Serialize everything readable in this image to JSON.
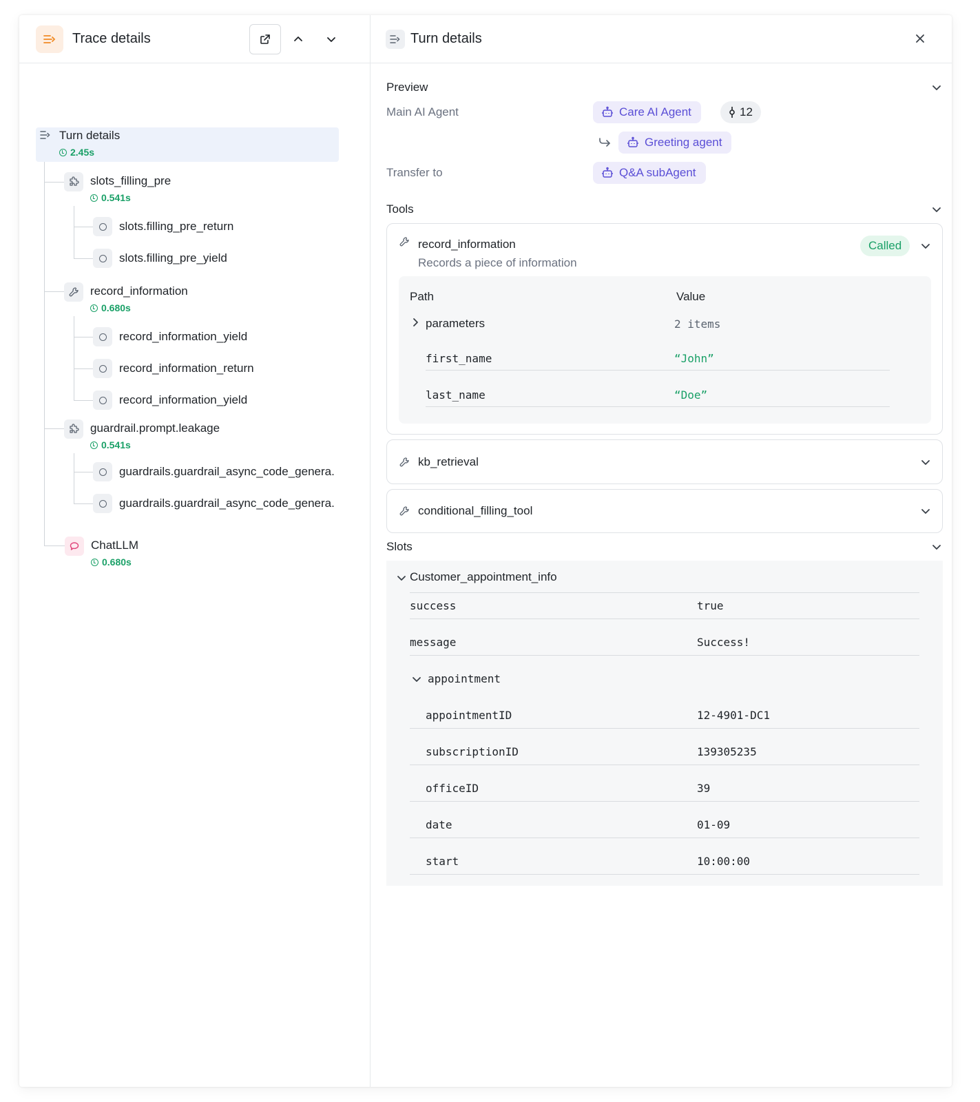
{
  "colors": {
    "accent_orange": "#f08a24",
    "success_green": "#1aa067",
    "agent_purple": "#5b4fd6",
    "chat_pink": "#e0457b",
    "selected_bg": "#edf2fb"
  },
  "left_panel": {
    "title": "Trace details",
    "header_icon": "lines-arrow-icon",
    "actions": [
      "external-link-icon",
      "chevron-up-icon",
      "chevron-down-icon"
    ]
  },
  "tree": {
    "root": {
      "name": "Turn details",
      "time": "2.45s",
      "icon": "lines-arrow-icon"
    },
    "nodes": [
      {
        "name": "slots_filling_pre",
        "time": "0.541s",
        "icon": "puzzle-icon",
        "children": [
          "slots.filling_pre_return",
          "slots.filling_pre_yield"
        ]
      },
      {
        "name": "record_information",
        "time": "0.680s",
        "icon": "wrench-icon",
        "children": [
          "record_information_yield",
          "record_information_return",
          "record_information_yield"
        ]
      },
      {
        "name": "guardrail.prompt.leakage",
        "time": "0.541s",
        "icon": "puzzle-icon",
        "children": [
          "guardrails.guardrail_async_code_genera.",
          "guardrails.guardrail_async_code_genera."
        ]
      },
      {
        "name": "ChatLLM",
        "time": "0.680s",
        "icon": "chat-bubble-icon",
        "children": []
      }
    ]
  },
  "right_panel": {
    "title": "Turn details",
    "preview": {
      "title": "Preview",
      "main_agent_label": "Main AI Agent",
      "main_agent": "Care AI Agent",
      "main_agent_count": "12",
      "handoff_agent": "Greeting agent",
      "transfer_label": "Transfer to",
      "transfer_agent": "Q&A subAgent"
    },
    "tools": {
      "title": "Tools",
      "items": [
        {
          "name": "record_information",
          "description": "Records a piece of information",
          "status": "Called",
          "table": {
            "path_header": "Path",
            "value_header": "Value",
            "group_key": "parameters",
            "group_value": "2 items",
            "rows": [
              {
                "key": "first_name",
                "value": "“John”"
              },
              {
                "key": "last_name",
                "value": "“Doe”"
              }
            ]
          }
        },
        {
          "name": "kb_retrieval"
        },
        {
          "name": "conditional_filling_tool"
        }
      ]
    },
    "slots": {
      "title": "Slots",
      "group": "Customer_appointment_info",
      "rows": [
        {
          "key": "success",
          "value": "true"
        },
        {
          "key": "message",
          "value": "Success!"
        }
      ],
      "subgroup": "appointment",
      "subrows": [
        {
          "key": "appointmentID",
          "value": "12-4901-DC1"
        },
        {
          "key": "subscriptionID",
          "value": "139305235"
        },
        {
          "key": "officeID",
          "value": "39"
        },
        {
          "key": "date",
          "value": "01-09"
        },
        {
          "key": "start",
          "value": "10:00:00"
        }
      ]
    }
  }
}
